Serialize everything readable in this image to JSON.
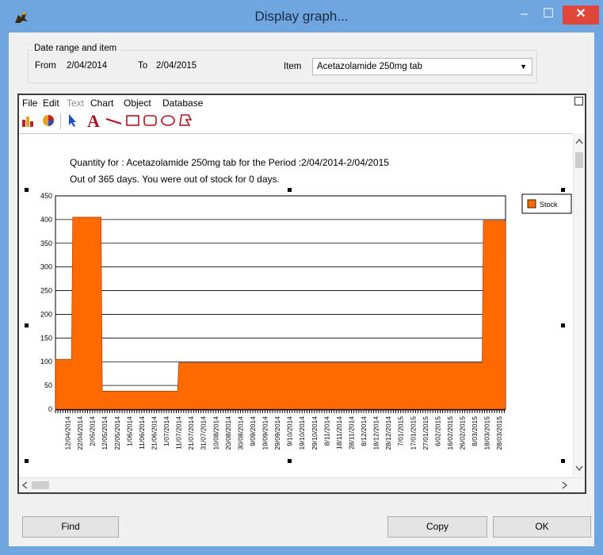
{
  "window": {
    "title": "Display graph...",
    "min_glyph": "–",
    "max_glyph": "☐",
    "close_glyph": "✕"
  },
  "date_range": {
    "group_title": "Date range and item",
    "from_label": "From",
    "from_value": "2/04/2014",
    "to_label": "To",
    "to_value": "2/04/2015",
    "item_label": "Item",
    "item_value": "Acetazolamide 250mg tab"
  },
  "menu": {
    "file": "File",
    "edit": "Edit",
    "text": "Text",
    "chart": "Chart",
    "object": "Object",
    "database": "Database"
  },
  "toolbar": {
    "text_tool_glyph": "A"
  },
  "buttons": {
    "find": "Find",
    "copy": "Copy",
    "ok": "OK"
  },
  "colors": {
    "stock": "#ff6a00",
    "title_bar": "#6fa6e0",
    "close": "#e0463a"
  },
  "chart_data": {
    "type": "area",
    "title": "Quantity for : Acetazolamide 250mg tab for the Period :2/04/2014-2/04/2015",
    "subtitle": "Out of 365 days. You were out of stock for 0 days.",
    "legend": [
      "Stock"
    ],
    "legend_position": "top-right",
    "ylim": [
      0,
      450
    ],
    "yticks": [
      0,
      50,
      100,
      150,
      200,
      250,
      300,
      350,
      400,
      450
    ],
    "grid": true,
    "xtick_labels": [
      "12/04/2014",
      "22/04/2014",
      "2/05/2014",
      "12/05/2014",
      "22/05/2014",
      "1/06/2014",
      "11/06/2014",
      "21/06/2014",
      "1/07/2014",
      "11/07/2014",
      "21/07/2014",
      "31/07/2014",
      "10/08/2014",
      "20/08/2014",
      "30/08/2014",
      "9/09/2014",
      "19/09/2014",
      "29/09/2014",
      "9/10/2014",
      "19/10/2014",
      "29/10/2014",
      "8/11/2014",
      "18/11/2014",
      "28/11/2014",
      "8/12/2014",
      "18/12/2014",
      "28/12/2014",
      "7/01/2015",
      "17/01/2015",
      "27/01/2015",
      "6/02/2015",
      "16/02/2015",
      "26/02/2015",
      "8/03/2015",
      "18/03/2015",
      "28/03/2015"
    ],
    "series": [
      {
        "name": "Stock",
        "x": [
          "2/04/2014",
          "15/04/2014",
          "16/04/2014",
          "9/05/2014",
          "10/05/2014",
          "10/07/2014",
          "11/07/2014",
          "14/03/2015",
          "15/03/2015",
          "2/04/2015"
        ],
        "values": [
          105,
          105,
          405,
          405,
          38,
          38,
          98,
          98,
          398,
          398
        ]
      }
    ]
  }
}
